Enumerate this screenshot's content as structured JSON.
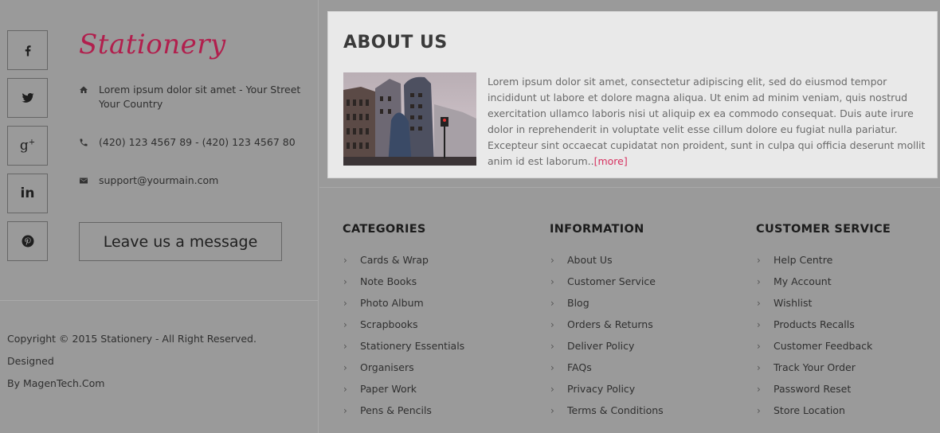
{
  "social": {
    "items": [
      {
        "icon": "facebook-icon",
        "glyph": "f"
      },
      {
        "icon": "twitter-icon",
        "glyph": "t"
      },
      {
        "icon": "google-plus-icon",
        "glyph": "g+"
      },
      {
        "icon": "linkedin-icon",
        "glyph": "in"
      },
      {
        "icon": "pinterest-icon",
        "glyph": "p"
      }
    ]
  },
  "brand": {
    "logo_text": "Stationery",
    "logo_color": "#b11f4d"
  },
  "contact": {
    "address_line1": "Lorem ipsum dolor sit amet - Your Street",
    "address_line2": "Your Country",
    "phone": "(420) 123 4567 89 - (420) 123 4567 80",
    "email": "support@yourmain.com",
    "message_button": "Leave us a message"
  },
  "copyright": {
    "line1": "Copyright © 2015 Stationery - All Right Reserved. Designed",
    "line2": "By MagenTech.Com"
  },
  "about": {
    "title": "ABOUT US",
    "text": "Lorem ipsum dolor sit amet, consectetur adipiscing elit, sed do eiusmod tempor incididunt ut labore et dolore magna aliqua. Ut enim ad minim veniam, quis nostrud exercitation ullamco laboris nisi ut aliquip ex ea commodo consequat. Duis aute irure dolor in reprehenderit in voluptate velit esse cillum dolore eu fugiat nulla pariatur. Excepteur sint occaecat cupidatat non proident, sunt in culpa qui officia deserunt mollit anim id est laborum..",
    "more_label": "[more]",
    "accent_color": "#d6305f"
  },
  "categories": {
    "title": "CATEGORIES",
    "items": [
      "Cards & Wrap",
      "Note Books",
      "Photo Album",
      "Scrapbooks",
      "Stationery Essentials",
      "Organisers",
      "Paper Work",
      "Pens & Pencils"
    ]
  },
  "information": {
    "title": "INFORMATION",
    "items": [
      "About Us",
      "Customer Service",
      "Blog",
      "Orders & Returns",
      "Deliver Policy",
      "FAQs",
      "Privacy Policy",
      "Terms & Conditions"
    ]
  },
  "customer_service": {
    "title": "CUSTOMER SERVICE",
    "items": [
      "Help Centre",
      "My Account",
      "Wishlist",
      "Products Recalls",
      "Customer Feedback",
      "Track Your Order",
      "Password Reset",
      "Store Location"
    ]
  }
}
